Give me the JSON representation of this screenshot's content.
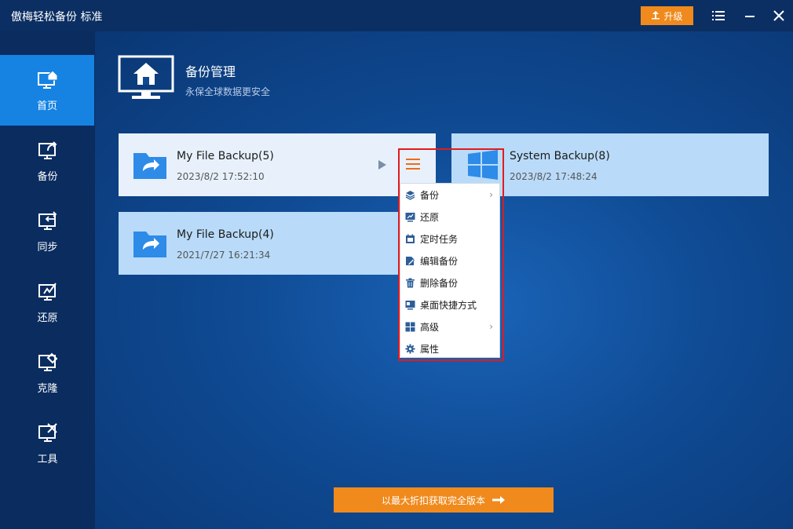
{
  "app": {
    "title": "傲梅轻松备份 标准",
    "upgrade_label": "升级"
  },
  "sidebar": {
    "items": [
      {
        "label": "首页",
        "icon": "home-monitor-icon",
        "active": true
      },
      {
        "label": "备份",
        "icon": "backup-monitor-icon"
      },
      {
        "label": "同步",
        "icon": "sync-monitor-icon"
      },
      {
        "label": "还原",
        "icon": "restore-monitor-icon"
      },
      {
        "label": "克隆",
        "icon": "clone-monitor-icon"
      },
      {
        "label": "工具",
        "icon": "tools-monitor-icon"
      }
    ]
  },
  "header": {
    "title": "备份管理",
    "subtitle": "永保全球数据更安全"
  },
  "backups": [
    {
      "name": "My File Backup(5)",
      "time": "2023/8/2 17:52:10",
      "icon": "folder-share-icon"
    },
    {
      "name": "My File Backup(4)",
      "time": "2021/7/27 16:21:34",
      "icon": "folder-share-icon"
    },
    {
      "name": "System Backup(8)",
      "time": "2023/8/2 17:48:24",
      "icon": "windows-icon"
    }
  ],
  "context_menu": {
    "items": [
      {
        "label": "备份",
        "icon": "layers-icon",
        "submenu": true
      },
      {
        "label": "还原",
        "icon": "restore-icon"
      },
      {
        "label": "定时任务",
        "icon": "calendar-icon"
      },
      {
        "label": "编辑备份",
        "icon": "edit-icon"
      },
      {
        "label": "删除备份",
        "icon": "trash-icon"
      },
      {
        "label": "桌面快捷方式",
        "icon": "shortcut-icon"
      },
      {
        "label": "高级",
        "icon": "grid-icon",
        "submenu": true
      },
      {
        "label": "属性",
        "icon": "settings-icon"
      }
    ],
    "highlight_color": "#e21b1b"
  },
  "promo": {
    "label": "以最大折扣获取完全版本"
  },
  "colors": {
    "accent": "#1683e3",
    "orange": "#f08a1c",
    "titlebar": "#0b2f63"
  }
}
